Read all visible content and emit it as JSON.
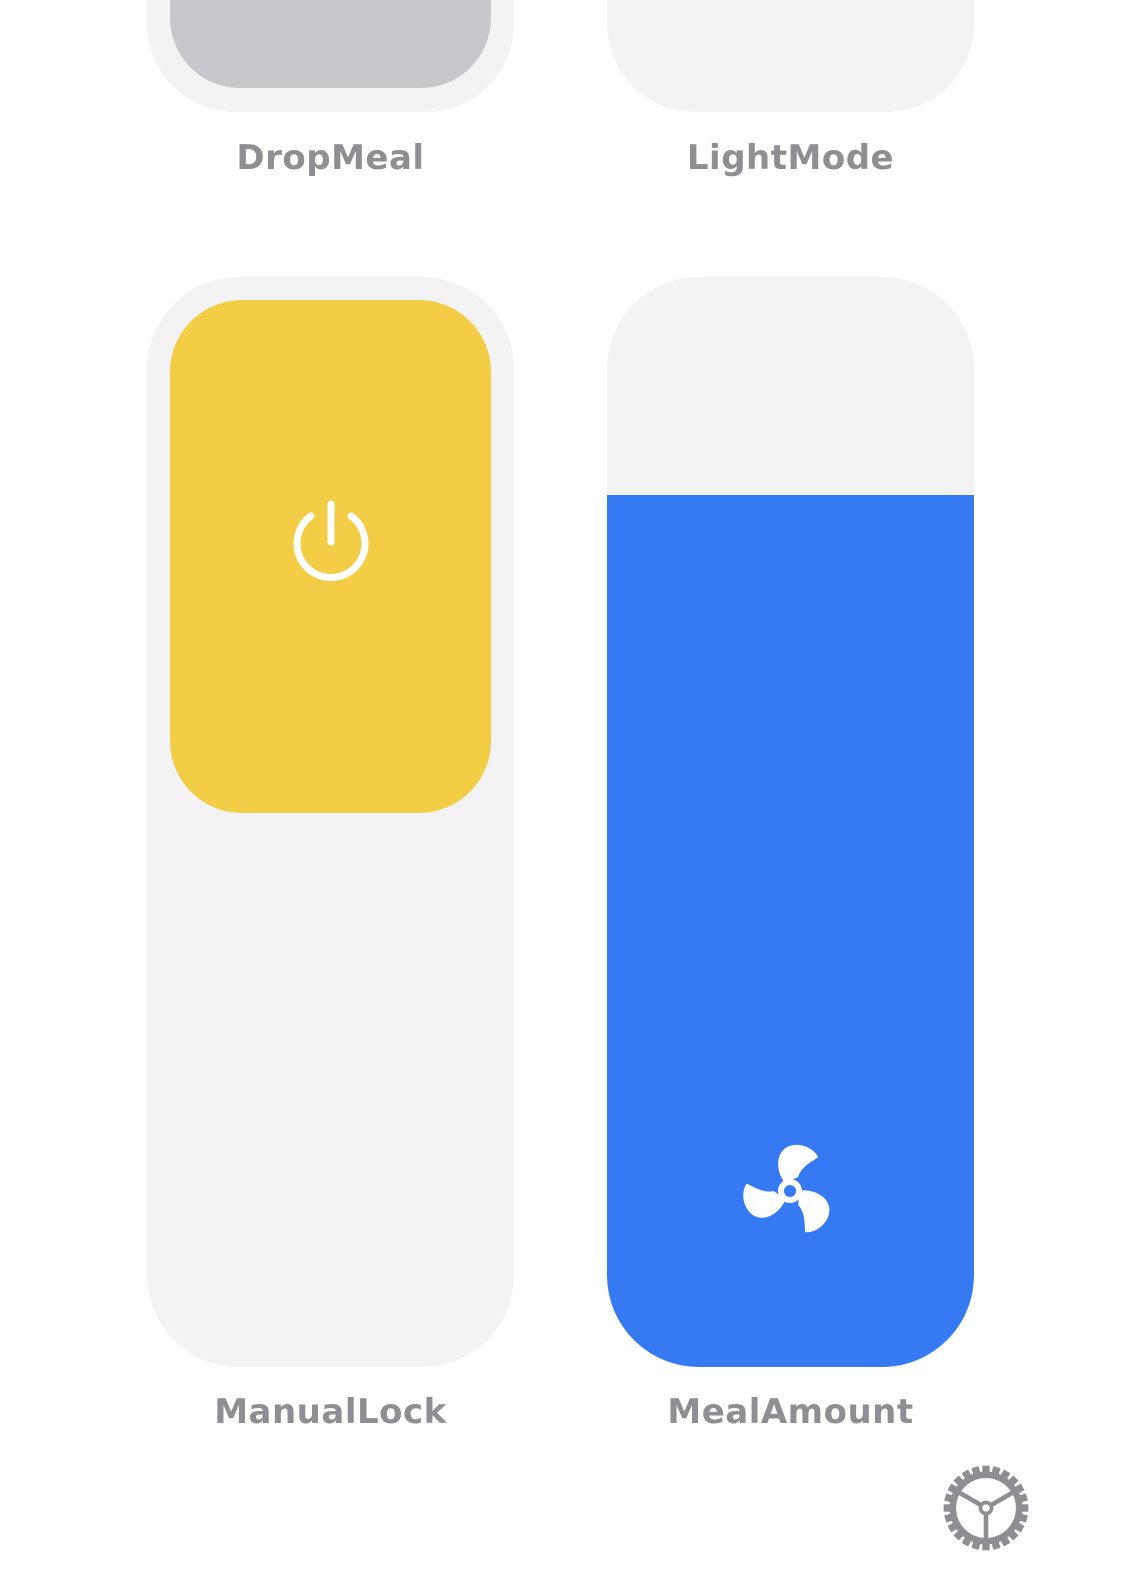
{
  "controls": {
    "drop_meal": {
      "label": "DropMeal",
      "knob_color": "#c7c7cc"
    },
    "light_mode": {
      "label": "LightMode"
    },
    "manual_lock": {
      "label": "ManualLock",
      "icon": "power-icon",
      "state": "on",
      "accent": "#f3cd45"
    },
    "meal_amount": {
      "label": "MealAmount",
      "icon": "fan-icon",
      "level": 0.8,
      "accent": "#3579f3"
    }
  },
  "colors": {
    "tile_background": "#f3f3f3",
    "label_text": "#8e8e93",
    "settings_icon": "#8e8e93"
  },
  "settings": {
    "icon": "gear-icon"
  }
}
